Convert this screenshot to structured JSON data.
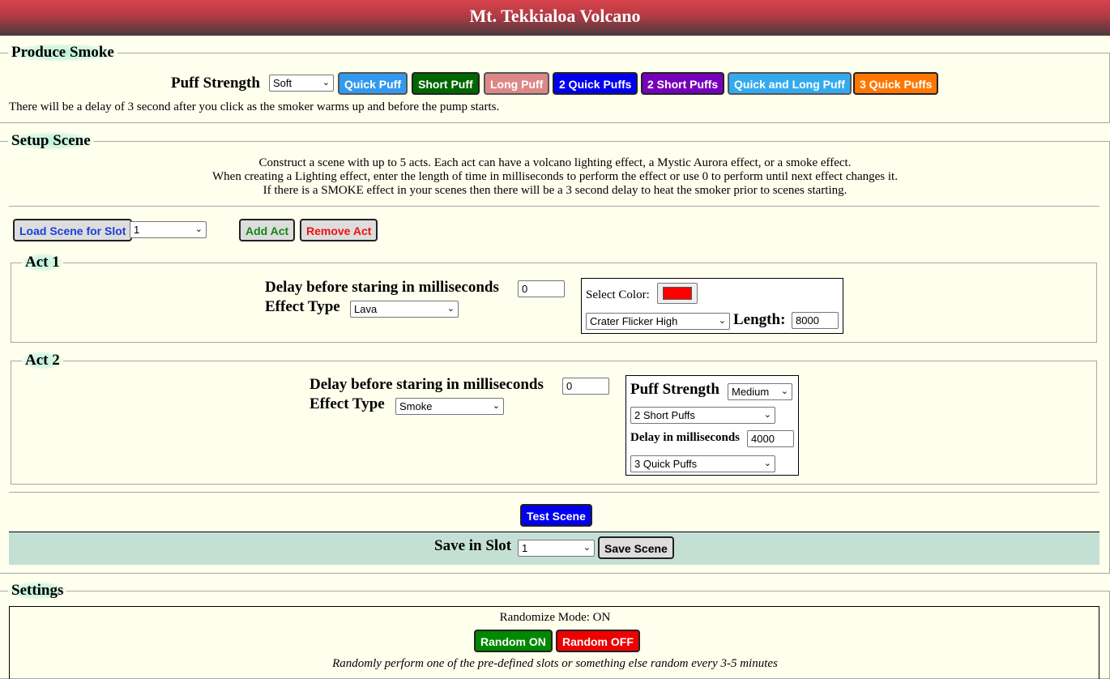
{
  "header": {
    "title": "Mt. Tekkialoa Volcano"
  },
  "produce_smoke": {
    "legend": "Produce Smoke",
    "puff_strength_label": "Puff Strength",
    "puff_strength_value": "Soft",
    "buttons": {
      "quick_puff": "Quick Puff",
      "short_puff": "Short Puff",
      "long_puff": "Long Puff",
      "two_quick_puffs": "2 Quick Puffs",
      "two_short_puffs": "2 Short Puffs",
      "quick_and_long_puff": "Quick and Long Puff",
      "three_quick_puffs": "3 Quick Puffs"
    },
    "note": "There will be a delay of 3 second after you click as the smoker warms up and before the pump starts."
  },
  "setup_scene": {
    "legend": "Setup Scene",
    "info_line1": "Construct a scene with up to 5 acts. Each act can have a volcano lighting effect, a Mystic Aurora effect, or a smoke effect.",
    "info_line2": "When creating a Lighting effect, enter the length of time in milliseconds to perform the effect or use 0 to perform until next effect changes it.",
    "info_line3": "If there is a SMOKE effect in your scenes then there will be a 3 second delay to heat the smoker prior to scenes starting.",
    "load_scene_label": "Load Scene for Slot",
    "load_slot_value": "1",
    "add_act_label": "Add Act",
    "remove_act_label": "Remove Act",
    "act1": {
      "legend": "Act 1",
      "delay_label": "Delay before staring in milliseconds",
      "delay_value": "0",
      "effect_type_label": "Effect Type",
      "effect_type_value": "Lava",
      "select_color_label": "Select Color:",
      "color": "#ff0000",
      "effect_value": "Crater Flicker High",
      "length_label": "Length:",
      "length_value": "8000"
    },
    "act2": {
      "legend": "Act 2",
      "delay_label": "Delay before staring in milliseconds",
      "delay_value": "0",
      "effect_type_label": "Effect Type",
      "effect_type_value": "Smoke",
      "puff_strength_label": "Puff Strength",
      "puff_strength_value": "Medium",
      "first_puff_value": "2 Short Puffs",
      "delay_ms_label": "Delay in milliseconds",
      "delay_ms_value": "4000",
      "second_puff_value": "3 Quick Puffs"
    },
    "test_scene_label": "Test Scene",
    "save_in_slot_label": "Save in Slot",
    "save_slot_value": "1",
    "save_scene_label": "Save Scene"
  },
  "settings": {
    "legend": "Settings",
    "randomize_mode_text": "Randomize Mode: ON",
    "random_on_label": "Random ON",
    "random_off_label": "Random OFF",
    "random_note": "Randomly perform one of the pre-defined slots or something else random every 3-5 minutes"
  },
  "colors": {
    "quick_puff": "#3399ee",
    "short_puff": "#006600",
    "long_puff": "#dd8888",
    "two_quick_puffs": "#0000ee",
    "two_short_puffs": "#7700bb",
    "quick_and_long_puff": "#33aaee",
    "three_quick_puffs": "#ff7700",
    "random_on": "#008800",
    "random_off": "#ee0000"
  }
}
